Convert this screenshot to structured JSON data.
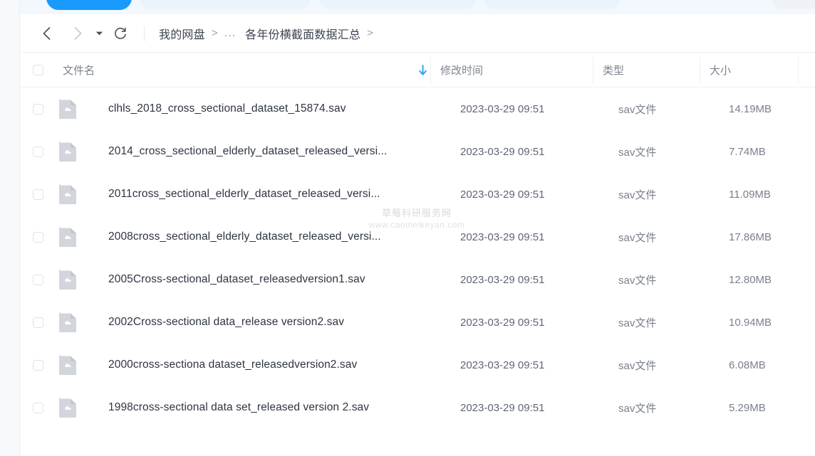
{
  "toolbar": {
    "primary_button_label": ""
  },
  "nav": {
    "back_icon": "chevron-left-icon",
    "forward_icon": "chevron-right-icon",
    "dropdown_icon": "caret-down-icon",
    "refresh_icon": "refresh-icon",
    "breadcrumb": {
      "root": "我的网盘",
      "sep": ">",
      "ellipsis": "...",
      "current": "各年份横截面数据汇总",
      "tail_sep": ">"
    }
  },
  "table": {
    "headers": {
      "select_all": "",
      "name": "文件名",
      "modified": "修改时间",
      "type": "类型",
      "size": "大小"
    },
    "sort": {
      "column": "文件名",
      "direction": "descending",
      "icon": "arrow-down-icon",
      "color": "#2ea7f3"
    },
    "rows": [
      {
        "name": "clhls_2018_cross_sectional_dataset_15874.sav",
        "modified": "2023-03-29 09:51",
        "type": "sav文件",
        "size": "14.19MB",
        "icon": "cloud-file-icon"
      },
      {
        "name": "2014_cross_sectional_elderly_dataset_released_versi...",
        "modified": "2023-03-29 09:51",
        "type": "sav文件",
        "size": "7.74MB",
        "icon": "cloud-file-icon"
      },
      {
        "name": "2011cross_sectional_elderly_dataset_released_versi...",
        "modified": "2023-03-29 09:51",
        "type": "sav文件",
        "size": "11.09MB",
        "icon": "cloud-file-icon"
      },
      {
        "name": "2008cross_sectional_elderly_dataset_released_versi...",
        "modified": "2023-03-29 09:51",
        "type": "sav文件",
        "size": "17.86MB",
        "icon": "cloud-file-icon"
      },
      {
        "name": "2005Cross-sectional_dataset_releasedversion1.sav",
        "modified": "2023-03-29 09:51",
        "type": "sav文件",
        "size": "12.80MB",
        "icon": "cloud-file-icon"
      },
      {
        "name": "2002Cross-sectional data_release version2.sav",
        "modified": "2023-03-29 09:51",
        "type": "sav文件",
        "size": "10.94MB",
        "icon": "cloud-file-icon"
      },
      {
        "name": "2000cross-sectiona dataset_releasedversion2.sav",
        "modified": "2023-03-29 09:51",
        "type": "sav文件",
        "size": "6.08MB",
        "icon": "cloud-file-icon"
      },
      {
        "name": "1998cross-sectional data set_released version 2.sav",
        "modified": "2023-03-29 09:51",
        "type": "sav文件",
        "size": "5.29MB",
        "icon": "cloud-file-icon"
      }
    ]
  },
  "watermark": {
    "title": "草莓科研服务网",
    "url": "www.caomeikeyan.com"
  },
  "colors": {
    "accent": "#1a9bfc",
    "sort_arrow": "#2ea7f3",
    "text_primary": "#2e3440",
    "text_secondary": "#7a808b",
    "border": "#eef0f3"
  }
}
